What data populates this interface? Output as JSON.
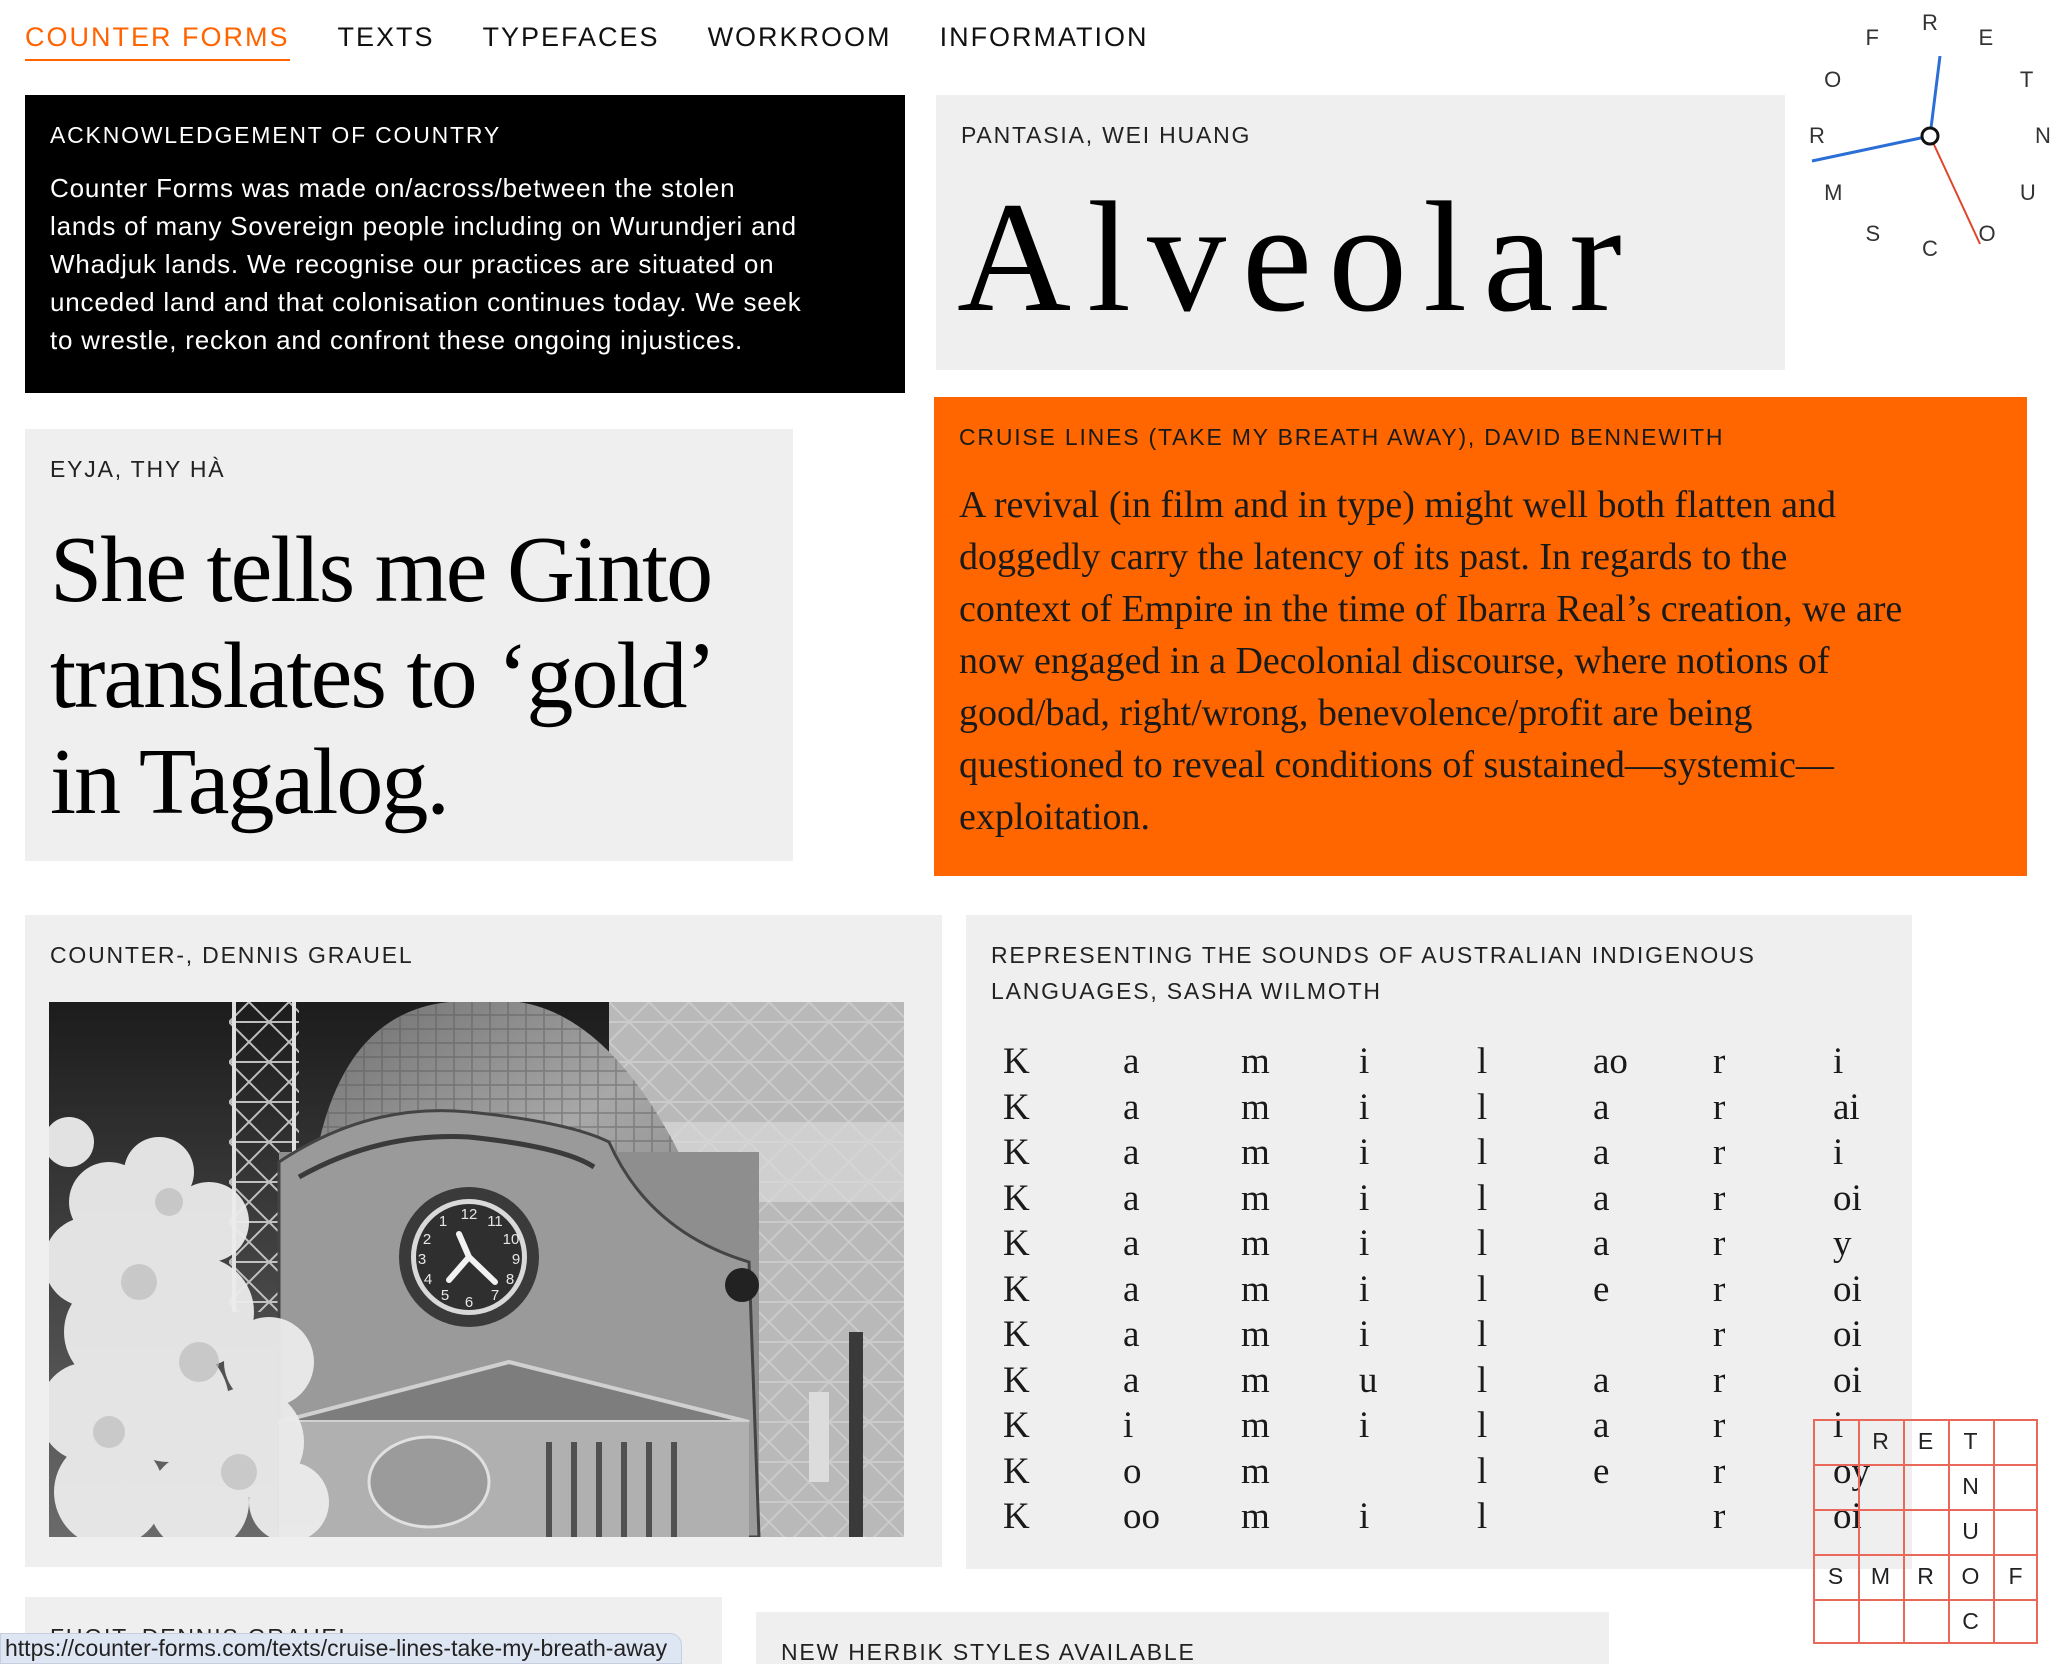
{
  "nav": {
    "items": [
      {
        "label": "COUNTER FORMS",
        "active": true
      },
      {
        "label": "TEXTS"
      },
      {
        "label": "TYPEFACES"
      },
      {
        "label": "WORKROOM"
      },
      {
        "label": "INFORMATION"
      }
    ]
  },
  "ack": {
    "label": "ACKNOWLEDGEMENT OF COUNTRY",
    "lines": [
      "Counter Forms was made on/across/between the stolen",
      "lands of many Sovereign people including on Wurundjeri and",
      "Whadjuk lands. We recognise our practices are situated on",
      "unceded land and that colonisation continues today. We seek",
      "to wrestle, reckon and confront these ongoing injustices."
    ]
  },
  "pantasia": {
    "label": "PANTASIA, WEI HUANG",
    "specimen": "Alveolar"
  },
  "eyja": {
    "label": "EYJA, THY HÀ",
    "lines": [
      "She tells me Ginto",
      "translates to ‘gold’",
      "in Tagalog."
    ]
  },
  "cruise": {
    "label": "CRUISE LINES (TAKE MY BREATH AWAY), DAVID BENNEWITH",
    "lines": [
      "A revival (in film and in type) might well both flatten and",
      "doggedly carry the latency of its past. In regards to the",
      "context of Empire in the time of Ibarra Real’s creation, we are",
      "now engaged in a Decolonial discourse, where notions of",
      "good/bad, right/wrong, benevolence/profit are being",
      "questioned to reveal conditions of sustained—systemic—",
      "exploitation."
    ]
  },
  "counter": {
    "label": "COUNTER-, DENNIS GRAUEL"
  },
  "sounds": {
    "label_lines": [
      "REPRESENTING THE SOUNDS OF AUSTRALIAN INDIGENOUS",
      "LANGUAGES, SASHA WILMOTH"
    ],
    "rows": [
      [
        "K",
        "a",
        "m",
        "i",
        "l",
        "ao",
        "r",
        "i"
      ],
      [
        "K",
        "a",
        "m",
        "i",
        "l",
        "a",
        "r",
        "ai"
      ],
      [
        "K",
        "a",
        "m",
        "i",
        "l",
        "a",
        "r",
        "i"
      ],
      [
        "K",
        "a",
        "m",
        "i",
        "l",
        "a",
        "r",
        "oi"
      ],
      [
        "K",
        "a",
        "m",
        "i",
        "l",
        "a",
        "r",
        "y"
      ],
      [
        "K",
        "a",
        "m",
        "i",
        "l",
        "e",
        "r",
        "oi"
      ],
      [
        "K",
        "a",
        "m",
        "i",
        "l",
        "",
        "r",
        "oi"
      ],
      [
        "K",
        "a",
        "m",
        "u",
        "l",
        "a",
        "r",
        "oi"
      ],
      [
        "K",
        "i",
        "m",
        "i",
        "l",
        "a",
        "r",
        "i"
      ],
      [
        "K",
        "o",
        "m",
        "",
        "l",
        "e",
        "r",
        "oy"
      ],
      [
        "K",
        "oo",
        "m",
        "i",
        "l",
        "",
        "r",
        "oi"
      ]
    ]
  },
  "fugit": {
    "label": "FUGIT, DENNIS GRAUEL"
  },
  "herbik": {
    "label": "NEW HERBIK STYLES AVAILABLE"
  },
  "compass": {
    "letters": [
      "R",
      "E",
      "T",
      "N",
      "U",
      "O",
      "C",
      "S",
      "M",
      "R",
      "O",
      "F"
    ]
  },
  "crossword": {
    "cells": [
      {
        "r": 0,
        "c": 1,
        "t": "R"
      },
      {
        "r": 0,
        "c": 2,
        "t": "E"
      },
      {
        "r": 0,
        "c": 3,
        "t": "T"
      },
      {
        "r": 1,
        "c": 3,
        "t": "N"
      },
      {
        "r": 2,
        "c": 3,
        "t": "U"
      },
      {
        "r": 3,
        "c": 0,
        "t": "S"
      },
      {
        "r": 3,
        "c": 1,
        "t": "M"
      },
      {
        "r": 3,
        "c": 2,
        "t": "R"
      },
      {
        "r": 3,
        "c": 3,
        "t": "O"
      },
      {
        "r": 3,
        "c": 4,
        "t": "F"
      },
      {
        "r": 4,
        "c": 3,
        "t": "C"
      }
    ]
  },
  "status": {
    "url": "https://counter-forms.com/texts/cruise-lines-take-my-breath-away"
  },
  "colors": {
    "accent": "#ff6600",
    "compass_blue": "#2b6fd6",
    "compass_red": "#e0452a",
    "grid_red": "#e8685a"
  }
}
